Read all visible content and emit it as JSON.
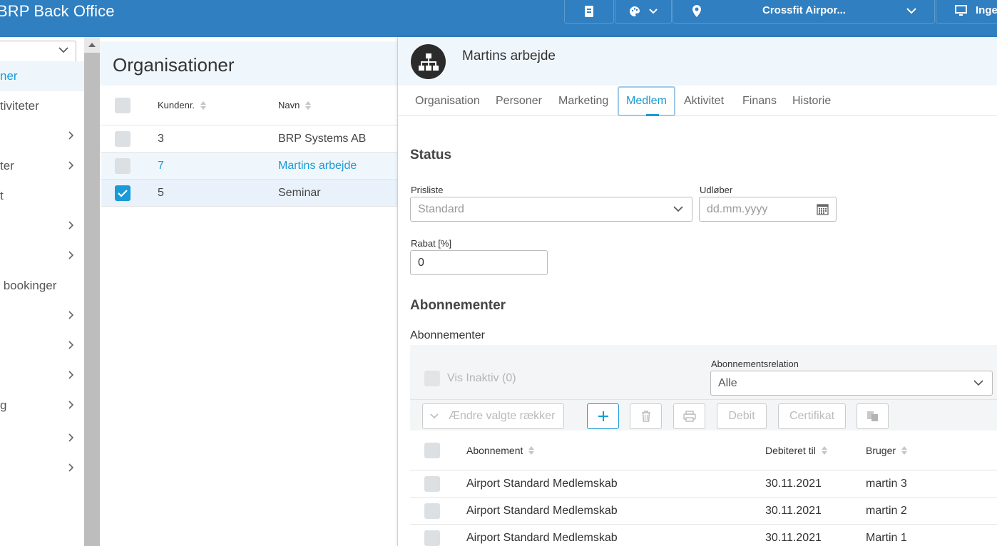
{
  "header": {
    "app_title": "BRP Back Office",
    "location": "Crossfit Airpor...",
    "user_partial": "Inge"
  },
  "nav": {
    "items": [
      {
        "label": "ner",
        "active": true,
        "arrow": false
      },
      {
        "label": "tiviteter",
        "active": false,
        "arrow": false
      },
      {
        "label": "",
        "active": false,
        "arrow": true
      },
      {
        "label": "ter",
        "active": false,
        "arrow": true
      },
      {
        "label": "t",
        "active": false,
        "arrow": false
      },
      {
        "label": "",
        "active": false,
        "arrow": true
      },
      {
        "label": "",
        "active": false,
        "arrow": true
      },
      {
        "label": " bookinger",
        "active": false,
        "arrow": false
      },
      {
        "label": "",
        "active": false,
        "arrow": true
      },
      {
        "label": "",
        "active": false,
        "arrow": true
      },
      {
        "label": "",
        "active": false,
        "arrow": true
      },
      {
        "label": "g",
        "active": false,
        "arrow": true
      },
      {
        "label": "",
        "active": false,
        "arrow": true
      },
      {
        "label": "",
        "active": false,
        "arrow": true
      }
    ]
  },
  "list": {
    "title": "Organisationer",
    "columns": {
      "kundenr": "Kundenr.",
      "navn": "Navn"
    },
    "rows": [
      {
        "kundenr": "3",
        "navn": "BRP Systems AB",
        "selected": false,
        "checked": false
      },
      {
        "kundenr": "7",
        "navn": "Martins arbejde",
        "selected": true,
        "checked": false
      },
      {
        "kundenr": "5",
        "navn": "Seminar",
        "selected": false,
        "checked": true
      }
    ]
  },
  "detail": {
    "title": "Martins arbejde",
    "tabs": [
      "Organisation",
      "Personer",
      "Marketing",
      "Medlem",
      "Aktivitet",
      "Finans",
      "Historie"
    ],
    "active_tab": "Medlem",
    "status": {
      "section_title": "Status",
      "prisliste_label": "Prisliste",
      "prisliste_value": "Standard",
      "udlober_label": "Udløber",
      "udlober_placeholder": "dd.mm.yyyy",
      "rabat_label": "Rabat [%]",
      "rabat_value": "0"
    },
    "abonnementer": {
      "section_title": "Abonnementer",
      "sub_label": "Abonnementer",
      "vis_inaktiv": "Vis Inaktiv (0)",
      "relation_label": "Abonnementsrelation",
      "relation_value": "Alle",
      "toolbar": {
        "change_rows": "Ændre valgte rækker",
        "debit": "Debit",
        "certifikat": "Certifikat"
      },
      "columns": {
        "abonnement": "Abonnement",
        "debiteret": "Debiteret til",
        "bruger": "Bruger"
      },
      "rows": [
        {
          "abonnement": "Airport Standard Medlemskab",
          "debiteret": "30.11.2021",
          "bruger": "martin 3"
        },
        {
          "abonnement": "Airport Standard Medlemskab",
          "debiteret": "30.11.2021",
          "bruger": "martin 2"
        },
        {
          "abonnement": "Airport Standard Medlemskab",
          "debiteret": "30.11.2021",
          "bruger": "Martin 1"
        }
      ]
    }
  }
}
